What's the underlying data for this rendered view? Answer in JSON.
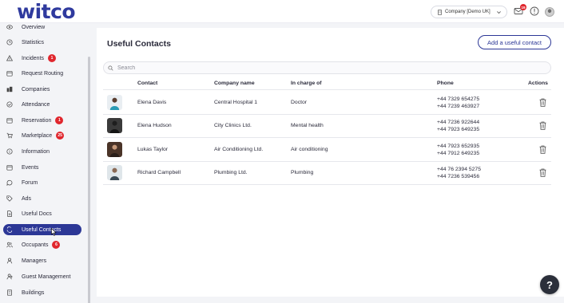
{
  "brand": {
    "logo_text": "witco",
    "color": "#2f3a9e"
  },
  "header": {
    "company_select": "Company [Demo UK]",
    "mail_badge": "19",
    "icons": [
      "building-icon",
      "chevron-down-icon",
      "mail-icon",
      "info-icon",
      "user-avatar"
    ]
  },
  "sidebar": {
    "items": [
      {
        "label": "Overview",
        "icon": "eye-icon"
      },
      {
        "label": "Statistics",
        "icon": "clock-icon"
      },
      {
        "label": "Incidents",
        "icon": "warning-icon",
        "badge": "1"
      },
      {
        "label": "Request Routing",
        "icon": "calendar-icon"
      },
      {
        "label": "Companies",
        "icon": "companies-icon"
      },
      {
        "label": "Attendance",
        "icon": "check-circle-icon"
      },
      {
        "label": "Reservation",
        "icon": "calendar-icon",
        "badge": "1"
      },
      {
        "label": "Marketplace",
        "icon": "cart-icon",
        "badge": "25"
      },
      {
        "label": "Information",
        "icon": "info-icon"
      },
      {
        "label": "Events",
        "icon": "calendar-icon"
      },
      {
        "label": "Forum",
        "icon": "chat-icon"
      },
      {
        "label": "Ads",
        "icon": "tag-icon"
      },
      {
        "label": "Useful Docs",
        "icon": "document-icon"
      },
      {
        "label": "Useful Contacts",
        "icon": "contacts-icon",
        "active": true
      },
      {
        "label": "Occupants",
        "icon": "users-icon",
        "badge": "6"
      },
      {
        "label": "Managers",
        "icon": "user-icon"
      },
      {
        "label": "Guest Management",
        "icon": "guest-icon"
      },
      {
        "label": "Buildings",
        "icon": "building-icon"
      }
    ],
    "active_color": "#2c3796",
    "badge_color": "#e0262d"
  },
  "main": {
    "title": "Useful Contacts",
    "add_button": "Add a useful contact",
    "search_placeholder": "Search",
    "columns": {
      "contact": "Contact",
      "company": "Company name",
      "in_charge": "In charge of",
      "phone": "Phone",
      "actions": "Actions"
    },
    "rows": [
      {
        "name": "Elena Davis",
        "company": "Central Hospital 1",
        "in_charge": "Doctor",
        "phone1": "+44 7329 654275",
        "phone2": "+44 7239 463927"
      },
      {
        "name": "Elena Hudson",
        "company": "City Clinics Ltd.",
        "in_charge": "Mental health",
        "phone1": "+44 7236 922644",
        "phone2": "+44 7923 649235"
      },
      {
        "name": "Lukas Taylor",
        "company": "Air Conditioning Ltd.",
        "in_charge": "Air conditioning",
        "phone1": "+44 7923 652935",
        "phone2": "+44 7912 649235"
      },
      {
        "name": "Richard Campbell",
        "company": "Plumbing Ltd.",
        "in_charge": "Plumbing",
        "phone1": "+44 76 2394 5275",
        "phone2": "+44 7236 539456"
      }
    ]
  },
  "help": {
    "label": "?"
  }
}
